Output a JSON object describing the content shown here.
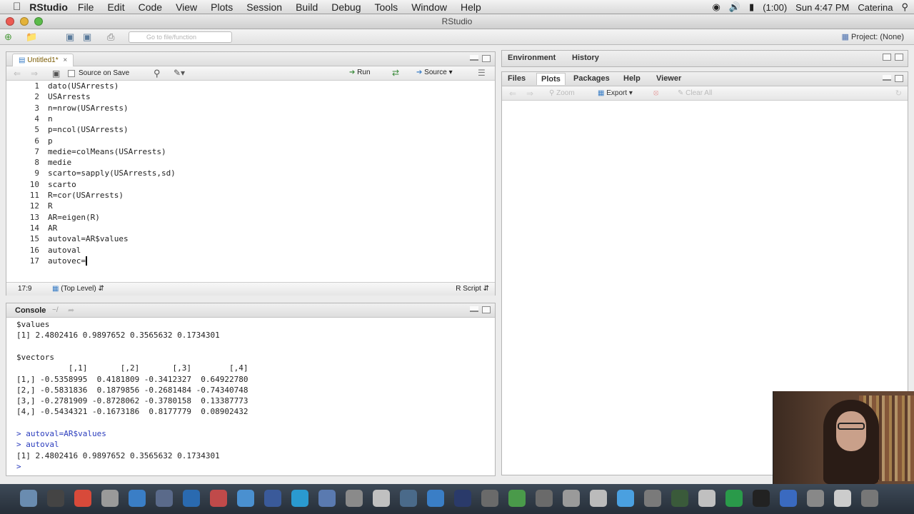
{
  "menubar": {
    "apple": "",
    "app": "RStudio",
    "menus": [
      "File",
      "Edit",
      "Code",
      "View",
      "Plots",
      "Session",
      "Build",
      "Debug",
      "Tools",
      "Window",
      "Help"
    ],
    "battery": "(1:00)",
    "clock": "Sun 4:47 PM",
    "user": "Caterina"
  },
  "window": {
    "title": "RStudio"
  },
  "toolbar": {
    "goto_placeholder": "Go to file/function",
    "project": "Project: (None)"
  },
  "editor": {
    "tab": "Untitled1*",
    "source_on_save": "Source on Save",
    "run": "Run",
    "source": "Source",
    "lines": [
      "dato(USArrests)",
      "USArrests",
      "n=nrow(USArrests)",
      "n",
      "p=ncol(USArrests)",
      "p",
      "medie=colMeans(USArrests)",
      "medie",
      "scarto=sapply(USArrests,sd)",
      "scarto",
      "R=cor(USArrests)",
      "R",
      "AR=eigen(R)",
      "AR",
      "autoval=AR$values",
      "autoval",
      "autovec="
    ],
    "status_pos": "17:9",
    "status_scope": "(Top Level)",
    "status_type": "R Script"
  },
  "console": {
    "title": "Console",
    "path": "~/",
    "lines": [
      {
        "text": "$values",
        "cls": ""
      },
      {
        "text": "[1] 2.4802416 0.9897652 0.3565632 0.1734301",
        "cls": ""
      },
      {
        "text": "",
        "cls": ""
      },
      {
        "text": "$vectors",
        "cls": ""
      },
      {
        "text": "           [,1]       [,2]       [,3]        [,4]",
        "cls": ""
      },
      {
        "text": "[1,] -0.5358995  0.4181809 -0.3412327  0.64922780",
        "cls": ""
      },
      {
        "text": "[2,] -0.5831836  0.1879856 -0.2681484 -0.74340748",
        "cls": ""
      },
      {
        "text": "[3,] -0.2781909 -0.8728062 -0.3780158  0.13387773",
        "cls": ""
      },
      {
        "text": "[4,] -0.5434321 -0.1673186  0.8177779  0.08902432",
        "cls": ""
      },
      {
        "text": "",
        "cls": ""
      },
      {
        "text": "> autoval=AR$values",
        "cls": "blue"
      },
      {
        "text": "> autoval",
        "cls": "blue"
      },
      {
        "text": "[1] 2.4802416 0.9897652 0.3565632 0.1734301",
        "cls": ""
      },
      {
        "text": "> ",
        "cls": "blue"
      }
    ]
  },
  "env": {
    "tab_environment": "Environment",
    "tab_history": "History"
  },
  "files": {
    "tabs": [
      "Files",
      "Plots",
      "Packages",
      "Help",
      "Viewer"
    ],
    "active": "Plots",
    "zoom": "Zoom",
    "export": "Export",
    "clear": "Clear All"
  },
  "colors": {
    "accent": "#5a7a9a",
    "console_input": "#2a3cbd"
  }
}
